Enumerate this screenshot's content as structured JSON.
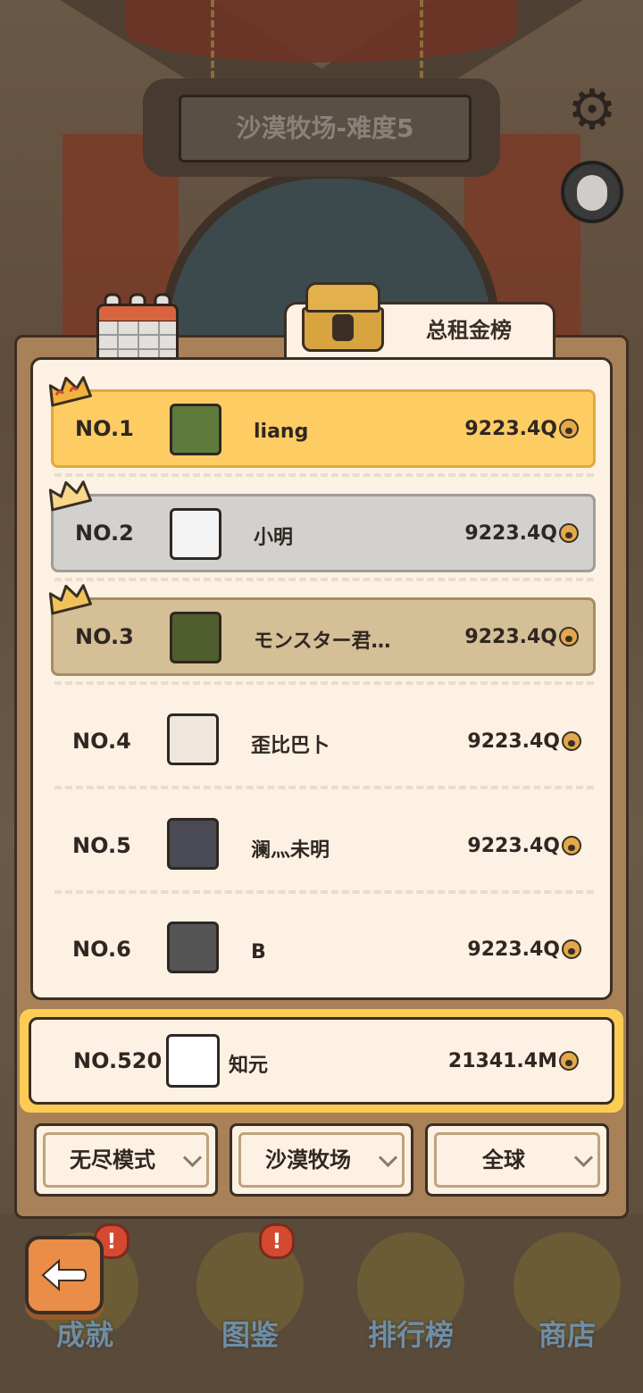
{
  "header": {
    "title": "沙漠牧场-难度5",
    "settings_icon": "gear-icon",
    "qq_icon": "qq-penguin-icon"
  },
  "tabs": [
    {
      "icon": "calendar-icon",
      "label": ""
    },
    {
      "icon": "treasure-chest-icon",
      "label": "总租金榜"
    }
  ],
  "leaderboard": {
    "rows": [
      {
        "rank": "NO.1",
        "name": "liang",
        "score": "9223.4Q",
        "tier": "gold"
      },
      {
        "rank": "NO.2",
        "name": "小明",
        "score": "9223.4Q",
        "tier": "silver"
      },
      {
        "rank": "NO.3",
        "name": "モンスター君…",
        "score": "9223.4Q",
        "tier": "bronze"
      },
      {
        "rank": "NO.4",
        "name": "歪比巴卜",
        "score": "9223.4Q",
        "tier": "none"
      },
      {
        "rank": "NO.5",
        "name": "澜灬未明",
        "score": "9223.4Q",
        "tier": "none"
      },
      {
        "rank": "NO.6",
        "name": "B",
        "score": "9223.4Q",
        "tier": "none"
      }
    ],
    "currency_icon": "paw-coin-icon"
  },
  "my_rank": {
    "rank": "NO.520",
    "name": "知元",
    "score": "21341.4M"
  },
  "filters": [
    {
      "label": "无尽模式"
    },
    {
      "label": "沙漠牧场"
    },
    {
      "label": "全球"
    }
  ],
  "bottom_nav": [
    {
      "label": "成就",
      "badge": "!"
    },
    {
      "label": "图鉴",
      "badge": "!"
    },
    {
      "label": "排行榜",
      "badge": ""
    },
    {
      "label": "商店",
      "badge": ""
    }
  ],
  "colors": {
    "gold_row": "#fdcd64",
    "silver_row": "#d3d1ce",
    "bronze_row": "#d5bf96",
    "panel_bg": "#fdf1e3",
    "back_button": "#e98d48"
  }
}
